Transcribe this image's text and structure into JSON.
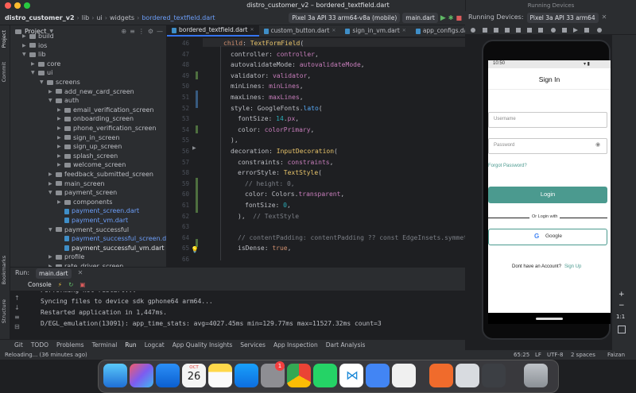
{
  "window": {
    "title": "distro_customer_v2 – bordered_textfield.dart",
    "running_devices_title": "Running Devices"
  },
  "navbar": {
    "project": "distro_customer_v2",
    "crumbs": [
      "lib",
      "ui",
      "widgets"
    ],
    "file": "bordered_textfield.dart",
    "device": "Pixel 3a API 33 arm64-v8a (mobile)",
    "config": "main.dart"
  },
  "left_stripe": {
    "project": "Project",
    "commit": "Commit",
    "bookmarks": "Bookmarks",
    "structure": "Structure"
  },
  "project_panel": {
    "title": "Project",
    "rows": [
      {
        "label": "build",
        "type": "folder",
        "depth": 1,
        "expanded": false
      },
      {
        "label": "ios",
        "type": "folder",
        "depth": 1,
        "expanded": false
      },
      {
        "label": "lib",
        "type": "folder",
        "depth": 1,
        "expanded": true
      },
      {
        "label": "core",
        "type": "folder",
        "depth": 2,
        "expanded": false
      },
      {
        "label": "ui",
        "type": "folder",
        "depth": 2,
        "expanded": true
      },
      {
        "label": "screens",
        "type": "folder",
        "depth": 3,
        "expanded": true
      },
      {
        "label": "add_new_card_screen",
        "type": "folder",
        "depth": 4,
        "expanded": false
      },
      {
        "label": "auth",
        "type": "folder",
        "depth": 4,
        "expanded": true
      },
      {
        "label": "email_verification_screen",
        "type": "folder",
        "depth": 5,
        "expanded": false
      },
      {
        "label": "onboarding_screen",
        "type": "folder",
        "depth": 5,
        "expanded": false
      },
      {
        "label": "phone_verification_screen",
        "type": "folder",
        "depth": 5,
        "expanded": false
      },
      {
        "label": "sign_in_screen",
        "type": "folder",
        "depth": 5,
        "expanded": false
      },
      {
        "label": "sign_up_screen",
        "type": "folder",
        "depth": 5,
        "expanded": false
      },
      {
        "label": "splash_screen",
        "type": "folder",
        "depth": 5,
        "expanded": false
      },
      {
        "label": "welcome_screen",
        "type": "folder",
        "depth": 5,
        "expanded": false
      },
      {
        "label": "feedback_submitted_screen",
        "type": "folder",
        "depth": 4,
        "expanded": false
      },
      {
        "label": "main_screen",
        "type": "folder",
        "depth": 4,
        "expanded": false
      },
      {
        "label": "payment_screen",
        "type": "folder",
        "depth": 4,
        "expanded": true
      },
      {
        "label": "components",
        "type": "folder",
        "depth": 5,
        "expanded": false
      },
      {
        "label": "payment_screen.dart",
        "type": "dart",
        "depth": 5
      },
      {
        "label": "payment_vm.dart",
        "type": "dart",
        "depth": 5
      },
      {
        "label": "payment_successful",
        "type": "folder",
        "depth": 4,
        "expanded": true
      },
      {
        "label": "payment_successful_screen.dart",
        "type": "dart",
        "depth": 5
      },
      {
        "label": "payment_successful_vm.dart",
        "type": "darkfile",
        "depth": 5
      },
      {
        "label": "profile",
        "type": "folder",
        "depth": 4,
        "expanded": false
      },
      {
        "label": "rate_driver_screen",
        "type": "folder",
        "depth": 4,
        "expanded": false
      }
    ]
  },
  "tabs": [
    "bordered_textfield.dart",
    "custom_button.dart",
    "sign_in_vm.dart",
    "app_configs.dart",
    "n"
  ],
  "editor": {
    "line_numbers": [
      "46",
      "47",
      "48",
      "49",
      "50",
      "51",
      "52",
      "53",
      "54",
      "55",
      "56",
      "57",
      "58",
      "59",
      "60",
      "61",
      "62",
      "63",
      "64",
      "65",
      "66"
    ],
    "lines": [
      {
        "n": "46",
        "indent": 2,
        "tokens": [
          [
            "kw",
            "child"
          ],
          [
            "p",
            ": "
          ],
          [
            "cls",
            "TextFormField"
          ],
          [
            "p",
            "("
          ]
        ]
      },
      {
        "n": "47",
        "indent": 3,
        "tokens": [
          [
            "p",
            "controller: "
          ],
          [
            "fld",
            "controller"
          ],
          [
            "p",
            ","
          ]
        ]
      },
      {
        "n": "48",
        "indent": 3,
        "tokens": [
          [
            "p",
            "autovalidateMode: "
          ],
          [
            "fld",
            "autovalidateMode"
          ],
          [
            "p",
            ","
          ]
        ]
      },
      {
        "n": "49",
        "indent": 3,
        "tokens": [
          [
            "p",
            "validator: "
          ],
          [
            "fld",
            "validator"
          ],
          [
            "p",
            ","
          ]
        ]
      },
      {
        "n": "50",
        "indent": 3,
        "tokens": [
          [
            "p",
            "minLines: "
          ],
          [
            "fld",
            "minLines"
          ],
          [
            "p",
            ","
          ]
        ]
      },
      {
        "n": "51",
        "indent": 3,
        "tokens": [
          [
            "p",
            "maxLines: "
          ],
          [
            "fld",
            "maxLines"
          ],
          [
            "p",
            ","
          ]
        ]
      },
      {
        "n": "52",
        "indent": 3,
        "tokens": [
          [
            "p",
            "style: GoogleFonts."
          ],
          [
            "fn",
            "lato"
          ],
          [
            "p",
            "("
          ]
        ]
      },
      {
        "n": "53",
        "indent": 4,
        "tokens": [
          [
            "p",
            "fontSize: "
          ],
          [
            "num",
            "14"
          ],
          [
            "p",
            "."
          ],
          [
            "fld",
            "px"
          ],
          [
            "p",
            ","
          ]
        ]
      },
      {
        "n": "54",
        "indent": 4,
        "tokens": [
          [
            "p",
            "color: "
          ],
          [
            "fld",
            "colorPrimary"
          ],
          [
            "p",
            ","
          ]
        ]
      },
      {
        "n": "55",
        "indent": 3,
        "tokens": [
          [
            "p",
            "),"
          ]
        ]
      },
      {
        "n": "56",
        "indent": 3,
        "tokens": [
          [
            "p",
            "decoration: "
          ],
          [
            "cls",
            "InputDecoration"
          ],
          [
            "p",
            "("
          ]
        ]
      },
      {
        "n": "57",
        "indent": 4,
        "tokens": [
          [
            "p",
            "constraints: "
          ],
          [
            "fld",
            "constraints"
          ],
          [
            "p",
            ","
          ]
        ]
      },
      {
        "n": "58",
        "indent": 4,
        "tokens": [
          [
            "p",
            "errorStyle: "
          ],
          [
            "cls",
            "TextStyle"
          ],
          [
            "p",
            "("
          ]
        ]
      },
      {
        "n": "59",
        "indent": 5,
        "tokens": [
          [
            "cmt",
            "// height: 0,"
          ]
        ]
      },
      {
        "n": "60",
        "indent": 5,
        "tokens": [
          [
            "p",
            "color: Colors."
          ],
          [
            "fld",
            "transparent"
          ],
          [
            "p",
            ","
          ]
        ]
      },
      {
        "n": "61",
        "indent": 5,
        "tokens": [
          [
            "p",
            "fontSize: "
          ],
          [
            "num",
            "0"
          ],
          [
            "p",
            ","
          ]
        ]
      },
      {
        "n": "62",
        "indent": 4,
        "tokens": [
          [
            "p",
            "),  "
          ],
          [
            "cmt",
            "// TextStyle"
          ]
        ]
      },
      {
        "n": "63",
        "indent": 0,
        "tokens": []
      },
      {
        "n": "64",
        "indent": 4,
        "tokens": [
          [
            "cmt",
            "// contentPadding: contentPadding ?? const EdgeInsets.symmetric"
          ]
        ]
      },
      {
        "n": "65",
        "indent": 4,
        "tokens": [
          [
            "p",
            "isDense: "
          ],
          [
            "kw",
            "true"
          ],
          [
            "p",
            ","
          ]
        ]
      },
      {
        "n": "66",
        "indent": 0,
        "tokens": []
      }
    ]
  },
  "run": {
    "label": "Run:",
    "config": "main.dart",
    "console_tab": "Console",
    "lines": [
      "Performing hot restart...",
      "Syncing files to device sdk gphone64 arm64...",
      "Restarted application in 1,447ms.",
      "D/EGL_emulation(13091): app_time_stats: avg=4027.45ms min=129.77ms max=11527.32ms count=3"
    ]
  },
  "toolbar": [
    "Git",
    "TODO",
    "Problems",
    "Terminal",
    "Run",
    "Logcat",
    "App Quality Insights",
    "Services",
    "App Inspection",
    "Dart Analysis"
  ],
  "status": {
    "left": "Reloading... (36 minutes ago)",
    "position": "65:25",
    "line_sep": "LF",
    "encoding": "UTF-8",
    "indent": "2 spaces",
    "user": "Faizan"
  },
  "devices": {
    "label": "Running Devices:",
    "device": "Pixel 3a API 33 arm64",
    "zoom": [
      "+",
      "−",
      "1:1"
    ]
  },
  "phone": {
    "time": "10:50",
    "title": "Sign In",
    "username_placeholder": "Username",
    "password_placeholder": "Password",
    "forgot": "Forgot Password?",
    "login": "Login",
    "or": "Or Login with",
    "google": "Google",
    "no_account": "Dont have an Account?",
    "signup": "Sign Up",
    "accent": "#4b9a8f"
  },
  "dock": {
    "calendar_month": "OCT",
    "calendar_day": "26",
    "badge": "1"
  }
}
